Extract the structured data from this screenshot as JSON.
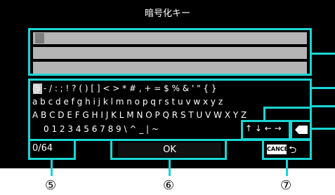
{
  "window": {
    "title": "暗号化キー"
  },
  "input": {
    "lines": [
      "",
      "",
      ""
    ]
  },
  "keyboard": {
    "row1": "@ - / : ; ! ? ( ) [ ] < > * # , + = $ % & ' \" { }",
    "row2": "a b c d e f g h i j k l m n o p q r s t u v w x y z",
    "row3": "A B C D E F G H I J K L M N O P Q R S T U V W X Y Z",
    "row4": "0 1 2 3 4 5 6 7 8 9 \\ ^ _ | ~",
    "dir_keys": "↑ ↓ ← →",
    "delete_key": "⌫",
    "selected_char": " "
  },
  "footer": {
    "count": "0/64",
    "ok": "OK",
    "cancel": "CANCEL"
  },
  "callouts": {
    "five": "⑤",
    "six": "⑥",
    "seven": "⑦"
  },
  "colors": {
    "accent": "#1ad6d4",
    "background": "#000000",
    "field": "#b4b4b4"
  }
}
